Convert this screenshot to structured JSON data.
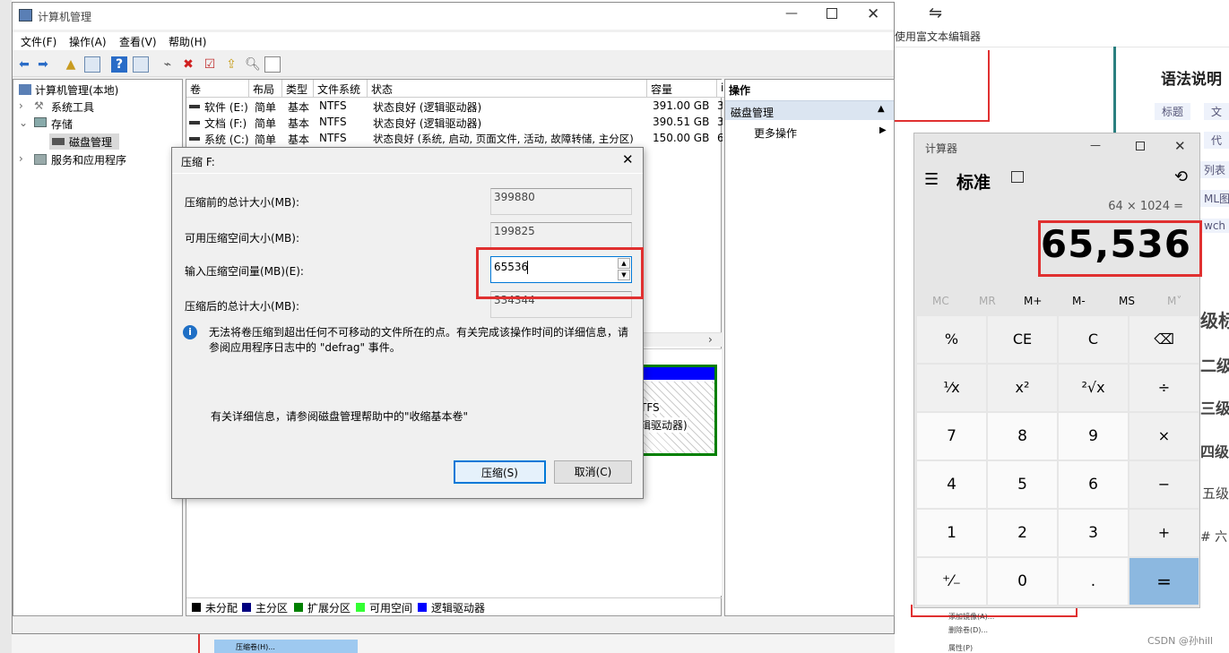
{
  "bg": {
    "toolbar_label": "使用富文本编辑器",
    "syntax_title": "语法说明",
    "tags": [
      "标题",
      "文",
      "代",
      "列表",
      "ML图",
      "wch"
    ],
    "headings": [
      "级标",
      "二级",
      "三级",
      "四级",
      "五级",
      "# 六"
    ],
    "watermark": "CSDN @孙hill",
    "menu_items": [
      "添加镜像(A)...",
      "删除卷(D)...",
      "属性(P)",
      "压缩卷(H)..."
    ]
  },
  "mmc": {
    "title": "计算机管理",
    "menus": [
      "文件(F)",
      "操作(A)",
      "查看(V)",
      "帮助(H)"
    ],
    "tree": [
      {
        "label": "计算机管理(本地)"
      },
      {
        "label": "系统工具"
      },
      {
        "label": "存储"
      },
      {
        "label": "磁盘管理"
      },
      {
        "label": "服务和应用程序"
      }
    ],
    "columns": [
      "卷",
      "布局",
      "类型",
      "文件系统",
      "状态",
      "容量",
      "i"
    ],
    "rows": [
      {
        "vol": "软件 (E:)",
        "layout": "简单",
        "type": "基本",
        "fs": "NTFS",
        "status": "状态良好 (逻辑驱动器)",
        "cap": "391.00 GB",
        "x": "3"
      },
      {
        "vol": "文档 (F:)",
        "layout": "简单",
        "type": "基本",
        "fs": "NTFS",
        "status": "状态良好 (逻辑驱动器)",
        "cap": "390.51 GB",
        "x": "3"
      },
      {
        "vol": "系统 (C:)",
        "layout": "简单",
        "type": "基本",
        "fs": "NTFS",
        "status": "状态良好 (系统, 启动, 页面文件, 活动, 故障转储, 主分区)",
        "cap": "150.00 GB",
        "x": "6"
      }
    ],
    "ops_header": "操作",
    "ops_section": "磁盘管理",
    "ops_more": "更多操作",
    "disk_fs": "TFS",
    "disk_status": "辑驱动器)",
    "legend": [
      "未分配",
      "主分区",
      "扩展分区",
      "可用空间",
      "逻辑驱动器"
    ],
    "legend_colors": [
      "#000000",
      "#000080",
      "#008000",
      "#33ff33",
      "#0000ff"
    ]
  },
  "dialog": {
    "title": "压缩 F:",
    "rows": [
      {
        "label": "压缩前的总计大小(MB):",
        "value": "399880"
      },
      {
        "label": "可用压缩空间大小(MB):",
        "value": "199825"
      },
      {
        "label": "输入压缩空间量(MB)(E):",
        "value": "65536"
      },
      {
        "label": "压缩后的总计大小(MB):",
        "value": "334344"
      }
    ],
    "info": "无法将卷压缩到超出任何不可移动的文件所在的点。有关完成该操作时间的详细信息，请参阅应用程序日志中的 \"defrag\" 事件。",
    "help": "有关详细信息，请参阅磁盘管理帮助中的\"收缩基本卷\"",
    "ok": "压缩(S)",
    "cancel": "取消(C)"
  },
  "calc": {
    "title": "计算器",
    "mode": "标准",
    "expression": "64 × 1024 =",
    "display": "65,536",
    "memory": [
      "MC",
      "MR",
      "M+",
      "M-",
      "MS",
      "M˅"
    ],
    "keys": [
      "%",
      "CE",
      "C",
      "⌫",
      "¹⁄x",
      "x²",
      "²√x",
      "÷",
      "7",
      "8",
      "9",
      "×",
      "4",
      "5",
      "6",
      "−",
      "1",
      "2",
      "3",
      "+",
      "⁺⁄₋",
      "0",
      ".",
      "="
    ]
  }
}
